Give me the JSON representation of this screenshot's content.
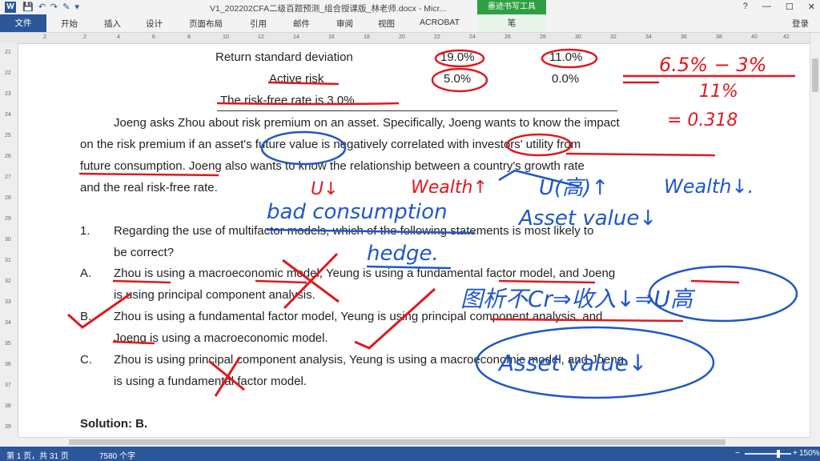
{
  "window": {
    "title": "V1_202202CFA二级百题预测_组合授课版_林老师.docx - Micr...",
    "contextual_tool": "墨迹书写工具",
    "controls": [
      "?",
      "—",
      "☐",
      "✕"
    ]
  },
  "ribbon": {
    "file": "文件",
    "tabs": [
      "开始",
      "插入",
      "设计",
      "页面布局",
      "引用",
      "邮件",
      "审阅",
      "视图",
      "ACROBAT"
    ],
    "pen_tab": "笔",
    "login": "登录"
  },
  "ruler_marks": [
    "2",
    "2",
    "4",
    "6",
    "8",
    "10",
    "12",
    "14",
    "16",
    "18",
    "20",
    "22",
    "24",
    "26",
    "28",
    "30",
    "32",
    "34",
    "36",
    "38",
    "40",
    "42"
  ],
  "vruler_marks": [
    "21",
    "22",
    "23",
    "24",
    "25",
    "26",
    "27",
    "28",
    "29",
    "30",
    "31",
    "32",
    "33",
    "34",
    "35",
    "36",
    "37",
    "38",
    "39"
  ],
  "doc": {
    "row_std_label": "Return standard deviation",
    "row_std_v1": "19.0%",
    "row_std_v2": "11.0%",
    "row_ar_label": "Active risk",
    "row_ar_v1": "5.0%",
    "row_ar_v2": "0.0%",
    "rf_label": "The risk-free rate is 3.0%",
    "para1": [
      "Joeng asks Zhou about risk premium on an asset. Specifically, Joeng wants to know the impact",
      "on the risk premium if an asset's future value is negatively correlated with investors' utility from",
      "future consumption. Joeng also wants to know the relationship between a country's growth rate",
      "and the real risk-free rate."
    ],
    "q_num": "1.",
    "q_text": [
      "Regarding the use of multifactor models, which of the following statements is most likely to",
      "be correct?"
    ],
    "options": [
      {
        "letter": "A.",
        "lines": [
          "Zhou is using a macroeconomic model, Yeung is using a fundamental factor model, and Joeng",
          "is using principal component analysis."
        ]
      },
      {
        "letter": "B.",
        "lines": [
          "Zhou is using a fundamental factor model, Yeung is using principal component analysis, and",
          "Joeng is using a macroeconomic model."
        ]
      },
      {
        "letter": "C.",
        "lines": [
          "Zhou is using principal component analysis, Yeung is using a macroeconomic model, and Joeng",
          "is using a fundamental factor model."
        ]
      }
    ],
    "solution": "Solution: B."
  },
  "ink": {
    "eq_top": "6.5% − 3%",
    "eq_bottom": "11%",
    "eq_result": "= 0.318",
    "u_down": "U↓",
    "wealth_up": "Wealth↑",
    "u_high_up": "U(高)↑",
    "wealth_down": "Wealth↓.",
    "bad_consumption": "bad consumption",
    "asset_value_down": "Asset value↓",
    "hedge": "hedge.",
    "chinese_note": "图析不Cr⇒收入↓⇒U高",
    "asset_value_down2": "Asset value↓"
  },
  "status": {
    "page": "第 1 页，共 31 页",
    "words": "7580 个字",
    "zoom": "150%",
    "zoom_minus": "−",
    "zoom_plus": "+"
  }
}
